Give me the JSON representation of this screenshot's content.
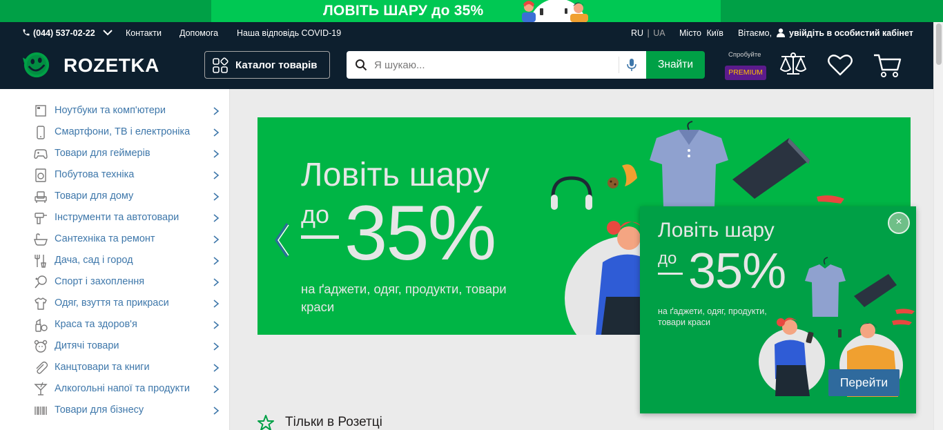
{
  "promo_strip": {
    "text": "ЛОВІТЬ ШАРУ до 35%"
  },
  "topline": {
    "phone": "(044) 537-02-22",
    "links": [
      "Контакти",
      "Допомога",
      "Наша відповідь COVID-19"
    ],
    "lang_ru": "RU",
    "lang_sep": "|",
    "lang_ua": "UA",
    "city_label": "Місто",
    "city": "Київ",
    "greeting": "Вітаємо,",
    "login": "увійдіть в особистий кабінет"
  },
  "header": {
    "logo": "ROZETKA",
    "catalog_label": "Каталог товарів",
    "search_placeholder": "Я шукаю...",
    "find_label": "Знайти",
    "premium_try": "Спробуйте",
    "premium_label": "PREMIUM"
  },
  "sidebar": {
    "items": [
      {
        "label": "Ноутбуки та комп'ютери",
        "icon": "laptop-icon"
      },
      {
        "label": "Смартфони, ТВ і електроніка",
        "icon": "smartphone-icon"
      },
      {
        "label": "Товари для геймерів",
        "icon": "gamepad-icon"
      },
      {
        "label": "Побутова техніка",
        "icon": "washing-machine-icon"
      },
      {
        "label": "Товари для дому",
        "icon": "armchair-icon"
      },
      {
        "label": "Інструменти та автотовари",
        "icon": "drill-icon"
      },
      {
        "label": "Сантехніка та ремонт",
        "icon": "bathtub-icon"
      },
      {
        "label": "Дача, сад і город",
        "icon": "garden-tools-icon"
      },
      {
        "label": "Спорт і захоплення",
        "icon": "tennis-racket-icon"
      },
      {
        "label": "Одяг, взуття та прикраси",
        "icon": "tshirt-icon"
      },
      {
        "label": "Краса та здоров'я",
        "icon": "cosmetics-icon"
      },
      {
        "label": "Дитячі товари",
        "icon": "teddy-bear-icon"
      },
      {
        "label": "Канцтовари та книги",
        "icon": "paperclip-icon"
      },
      {
        "label": "Алкогольні напої та продукти",
        "icon": "cocktail-icon"
      },
      {
        "label": "Товари для бізнесу",
        "icon": "barcode-icon"
      }
    ]
  },
  "banner": {
    "title": "Ловіть шару",
    "prefix": "до",
    "percent": "35%",
    "subtitle": "на ґаджети, одяг, продукти, товари краси"
  },
  "popup": {
    "title": "Ловіть шару",
    "prefix": "до",
    "percent": "35%",
    "subtitle": "на ґаджети, одяг, продукти, товари краси",
    "close": "×",
    "button": "Перейти"
  },
  "section": {
    "title": "Тільки в Розетці"
  },
  "colors": {
    "brand_green": "#00a046",
    "header_bg": "#0d1f2e",
    "link_blue": "#3e77aa",
    "premium_purple": "#5c1b8c"
  }
}
